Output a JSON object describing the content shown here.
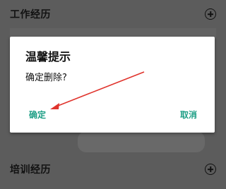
{
  "sections": {
    "work": {
      "title": "工作经历",
      "action_icon": "add-circle-icon"
    },
    "training": {
      "title": "培训经历",
      "action_icon": "add-circle-icon"
    }
  },
  "dialog": {
    "title": "温馨提示",
    "message": "确定删除?",
    "confirm_label": "确定",
    "cancel_label": "取消"
  },
  "colors": {
    "overlay": "#5c5c5c",
    "dialog_bg": "#ffffff",
    "accent": "#1f9f86",
    "annotation_arrow": "#e0342d"
  },
  "annotation": {
    "type": "arrow",
    "target": "confirm-button"
  }
}
